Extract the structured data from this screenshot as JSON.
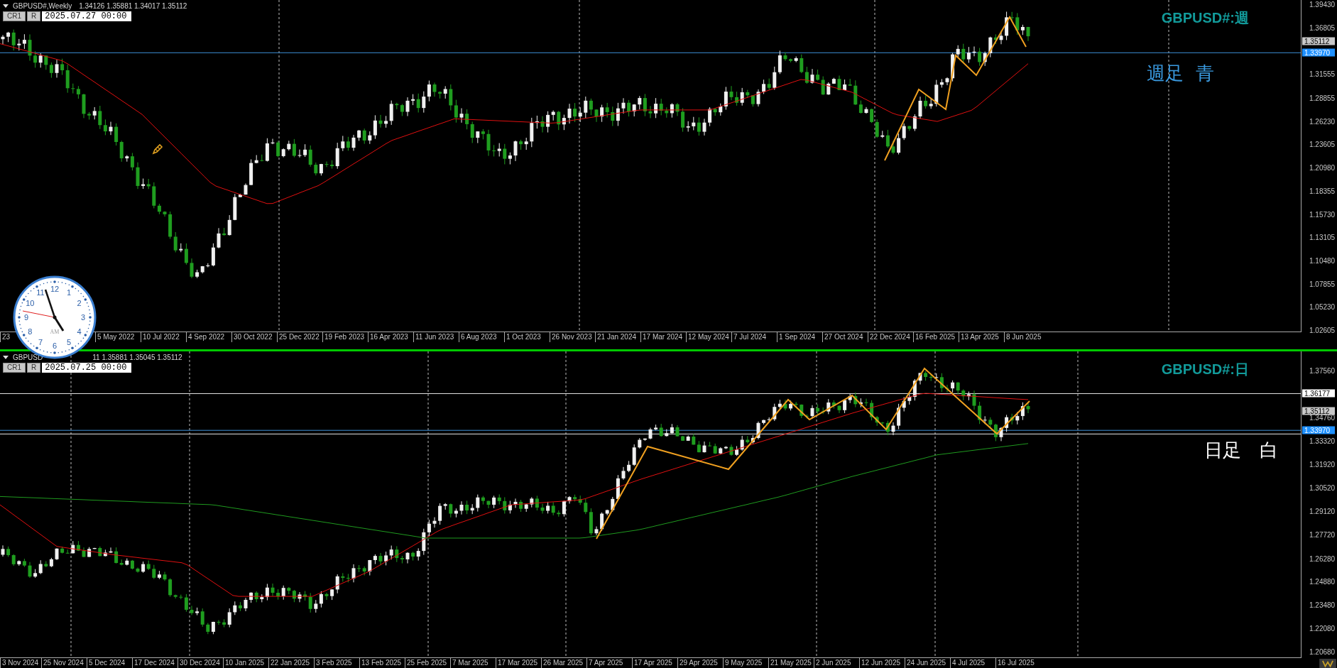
{
  "top_chart": {
    "header": {
      "symbol": "GBPUSD#,Weekly",
      "quote": "1.34126 1.35881 1.34017 1.35112",
      "buttons": [
        "CR1",
        "R"
      ],
      "date": "2025.07.27 00:00"
    },
    "title": "GBPUSD#:週",
    "note": "週足  青",
    "price_axis": [
      "1.39430",
      "1.36805",
      "1.31555",
      "1.28855",
      "1.26230",
      "1.23605",
      "1.20980",
      "1.18355",
      "1.15730",
      "1.13105",
      "1.10480",
      "1.07855",
      "1.05230",
      "1.02605"
    ],
    "price_tags": [
      {
        "text": "1.35112",
        "color": "#c8c8c8"
      },
      {
        "text": "1.33970",
        "color": "#1e90ff"
      }
    ],
    "time_axis": [
      "23",
      "5 May 2022",
      "10 Jul 2022",
      "4 Sep 2022",
      "30 Oct 2022",
      "25 Dec 2022",
      "19 Feb 2023",
      "16 Apr 2023",
      "11 Jun 2023",
      "6 Aug 2023",
      "1 Oct 2023",
      "26 Nov 2023",
      "21 Jan 2024",
      "17 Mar 2024",
      "12 May 2024",
      "7 Jul 2024",
      "1 Sep 2024",
      "27 Oct 2024",
      "22 Dec 2024",
      "16 Feb 2025",
      "13 Apr 2025",
      "8 Jun 2025"
    ]
  },
  "bottom_chart": {
    "header": {
      "symbol": "GBPUSD",
      "quote": "11 1.35881 1.35045 1.35112",
      "buttons": [
        "CR1",
        "R"
      ],
      "date": "2025.07.25 00:00"
    },
    "title": "GBPUSD#:日",
    "note": "日足　白",
    "price_axis": [
      "1.37560",
      "1.34760",
      "1.33320",
      "1.31920",
      "1.30520",
      "1.29120",
      "1.27720",
      "1.26280",
      "1.24880",
      "1.23480",
      "1.22080",
      "1.20680"
    ],
    "price_tags": [
      {
        "text": "1.36177",
        "color": "#ffffff"
      },
      {
        "text": "1.35112",
        "color": "#c8c8c8"
      },
      {
        "text": "1.33970",
        "color": "#1e90ff"
      }
    ],
    "time_axis": [
      "3 Nov 2024",
      "25 Nov 2024",
      "5 Dec 2024",
      "17 Dec 2024",
      "30 Dec 2024",
      "10 Jan 2025",
      "22 Jan 2025",
      "3 Feb 2025",
      "13 Feb 2025",
      "25 Feb 2025",
      "7 Mar 2025",
      "17 Mar 2025",
      "26 Mar 2025",
      "7 Apr 2025",
      "17 Apr 2025",
      "29 Apr 2025",
      "9 May 2025",
      "21 May 2025",
      "2 Jun 2025",
      "12 Jun 2025",
      "24 Jun 2025",
      "4 Jul 2025",
      "16 Jul 2025"
    ]
  },
  "clock": {
    "numerals": [
      "12",
      "1",
      "2",
      "3",
      "4",
      "5",
      "6",
      "7",
      "8",
      "9",
      "10",
      "11"
    ],
    "period": "AM"
  }
}
